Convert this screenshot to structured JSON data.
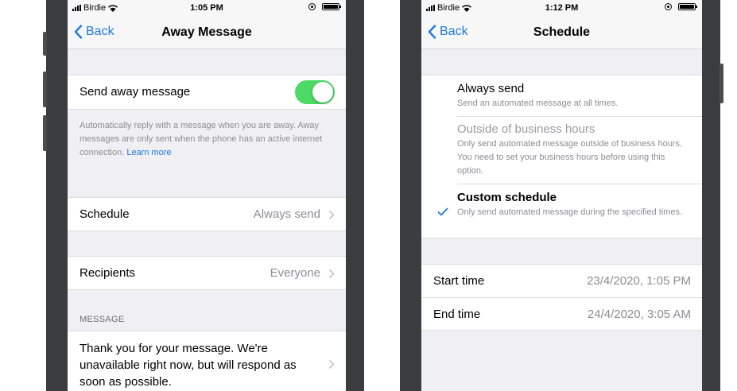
{
  "left": {
    "status": {
      "carrier": "Birdie",
      "time": "1:05 PM"
    },
    "nav": {
      "back": "Back",
      "title": "Away Message"
    },
    "toggle_row": {
      "label": "Send away message",
      "on": true
    },
    "footer": {
      "text": "Automatically reply with a message when you are away. Away messages are only sent when the phone has an active internet connection.",
      "link": "Learn more"
    },
    "schedule": {
      "label": "Schedule",
      "value": "Always send"
    },
    "recipients": {
      "label": "Recipients",
      "value": "Everyone"
    },
    "message_header": "MESSAGE",
    "message": "Thank you for your message. We're unavailable right now, but will respond as soon as possible."
  },
  "right": {
    "status": {
      "carrier": "Birdie",
      "time": "1:12 PM"
    },
    "nav": {
      "back": "Back",
      "title": "Schedule"
    },
    "options": [
      {
        "title": "Always send",
        "desc": "Send an automated message at all times."
      },
      {
        "title": "Outside of business hours",
        "desc": "Only send automated message outside of business hours. You need to set your business hours before using this option."
      },
      {
        "title": "Custom schedule",
        "desc": "Only send automated message during the specified times.",
        "selected": true
      }
    ],
    "start": {
      "label": "Start time",
      "value": "23/4/2020, 1:05 PM"
    },
    "end": {
      "label": "End time",
      "value": "24/4/2020, 3:05 AM"
    }
  },
  "colors": {
    "accent": "#1f7ae0",
    "toggle_on": "#4cd964",
    "background": "#efeff4"
  }
}
